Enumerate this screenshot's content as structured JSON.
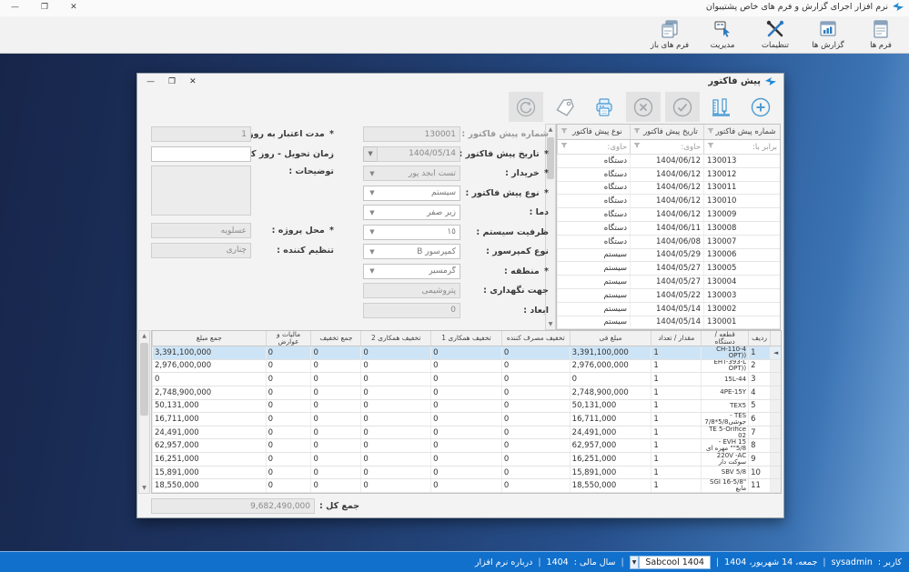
{
  "window": {
    "title": "نرم افزار اجرای گزارش و فرم های خاص پشتیبوان",
    "controls": {
      "close": "✕",
      "maximize": "❐",
      "minimize": "—"
    }
  },
  "ribbon": {
    "buttons": [
      {
        "id": "forms",
        "label": "فرم ها"
      },
      {
        "id": "reports",
        "label": "گزارش ها"
      },
      {
        "id": "settings",
        "label": "تنظیمات"
      },
      {
        "id": "management",
        "label": "مدیریت"
      },
      {
        "id": "open-forms",
        "label": "فرم های باز"
      }
    ]
  },
  "dialog": {
    "title": "پیش فاکتور",
    "controls": {
      "close": "✕",
      "maximize": "❐",
      "minimize": "—"
    },
    "toolbar": [
      {
        "name": "add",
        "enabled": true
      },
      {
        "name": "design",
        "enabled": true
      },
      {
        "name": "confirm",
        "enabled": false
      },
      {
        "name": "cancel",
        "enabled": false
      },
      {
        "name": "print",
        "enabled": true
      },
      {
        "name": "tag",
        "enabled": true
      },
      {
        "name": "refresh",
        "enabled": false
      }
    ],
    "list": {
      "columns": [
        "شماره پیش فاکتور",
        "تاریخ پیش فاکتور",
        "نوع پیش فاکتور"
      ],
      "filters": [
        "برابر با:",
        "حاوی:",
        "حاوی:"
      ],
      "rows": [
        [
          "130013",
          "1404/06/12",
          "دستگاه"
        ],
        [
          "130012",
          "1404/06/12",
          "دستگاه"
        ],
        [
          "130011",
          "1404/06/12",
          "دستگاه"
        ],
        [
          "130010",
          "1404/06/12",
          "دستگاه"
        ],
        [
          "130009",
          "1404/06/12",
          "دستگاه"
        ],
        [
          "130008",
          "1404/06/11",
          "دستگاه"
        ],
        [
          "130007",
          "1404/06/08",
          "دستگاه"
        ],
        [
          "130006",
          "1404/05/29",
          "سیستم"
        ],
        [
          "130005",
          "1404/05/27",
          "سیستم"
        ],
        [
          "130004",
          "1404/05/27",
          "سیستم"
        ],
        [
          "130003",
          "1404/05/22",
          "سیستم"
        ],
        [
          "130002",
          "1404/05/14",
          "سیستم"
        ],
        [
          "130001",
          "1404/05/14",
          "سیستم"
        ]
      ]
    },
    "form": {
      "center": [
        {
          "label": "شماره پیش فاکتور :",
          "value": "130001",
          "type": "readonly",
          "required": false,
          "dim": true
        },
        {
          "label": "تاریخ پیش فاکتور :",
          "value": "1404/05/14",
          "type": "datedrop",
          "required": true
        },
        {
          "label": "خریدار :",
          "value": "تست ابجد پور",
          "type": "dropdown-gray",
          "required": true
        },
        {
          "label": "نوع پیش فاکتور :",
          "value": "سیستم",
          "type": "dropdown",
          "required": true
        },
        {
          "label": "دما :",
          "value": "زیر صفر",
          "type": "dropdown",
          "required": false
        },
        {
          "label": "ظرفیت سیستم :",
          "value": "١٥",
          "type": "dropdown",
          "required": false
        },
        {
          "label": "نوع کمپرسور :",
          "value": "کمپرسور B",
          "type": "dropdown",
          "required": false
        },
        {
          "label": "منطقه :",
          "value": "گرمسیر",
          "type": "dropdown",
          "required": true
        },
        {
          "label": "جهت نگهداری :",
          "value": "پتروشیمی",
          "type": "readonly",
          "required": false
        },
        {
          "label": "ابعاد :",
          "value": "0",
          "type": "readonly",
          "required": false
        }
      ],
      "left": [
        {
          "label": "مدت اعتبار به روز :",
          "value": "1",
          "type": "readonly",
          "required": true
        },
        {
          "label": "زمان تحویل - روز کاری :",
          "value": "",
          "type": "text",
          "required": false
        },
        {
          "label": "توضیحات :",
          "value": "",
          "type": "textarea",
          "required": false
        },
        {
          "label": "محل پروژه :",
          "value": "عسلویه",
          "type": "readonly",
          "required": true
        },
        {
          "label": "تنظیم کننده :",
          "value": "چناری",
          "type": "readonly",
          "required": false
        }
      ]
    },
    "items": {
      "columns": [
        "ردیف",
        "قطعه / دستگاه",
        "مقدار / تعداد",
        "مبلغ فی",
        "تخفیف مصرف کننده",
        "تخفیف همکاری 1",
        "تخفیف همکاری 2",
        "جمع تخفیف",
        "مالیات و عوارض",
        "جمع مبلغ"
      ],
      "selected_row": 0,
      "rows": [
        [
          "1",
          "CH-110-4\n((OPT",
          "1",
          "3,391,100,000",
          "0",
          "0",
          "0",
          "0",
          "0",
          "3,391,100,000"
        ],
        [
          "2",
          "EHT-393-L\n((OPT",
          "1",
          "2,976,000,000",
          "0",
          "0",
          "0",
          "0",
          "0",
          "2,976,000,000"
        ],
        [
          "3",
          "15L-44",
          "1",
          "0",
          "0",
          "0",
          "0",
          "0",
          "0",
          "0"
        ],
        [
          "4",
          "4PE-15Y",
          "1",
          "2,748,900,000",
          "0",
          "0",
          "0",
          "0",
          "0",
          "2,748,900,000"
        ],
        [
          "5",
          "TEX5",
          "1",
          "50,131,000",
          "0",
          "0",
          "0",
          "0",
          "0",
          "50,131,000"
        ],
        [
          "6",
          "TES -\nجوشی5/8*7/8",
          "1",
          "16,711,000",
          "0",
          "0",
          "0",
          "0",
          "0",
          "16,711,000"
        ],
        [
          "7",
          "TE 5-Orifice\n02",
          "1",
          "24,491,000",
          "0",
          "0",
          "0",
          "0",
          "0",
          "24,491,000"
        ],
        [
          "8",
          "EVH 15 -\n5/8\"\" مهره ای",
          "1",
          "62,957,000",
          "0",
          "0",
          "0",
          "0",
          "0",
          "62,957,000"
        ],
        [
          "9",
          "220V -AC\nسوکت دار",
          "1",
          "16,251,000",
          "0",
          "0",
          "0",
          "0",
          "0",
          "16,251,000"
        ],
        [
          "10",
          "SBV 5/8",
          "1",
          "15,891,000",
          "0",
          "0",
          "0",
          "0",
          "0",
          "15,891,000"
        ],
        [
          "11",
          "\"SGI 16-5/8\nمایع",
          "1",
          "18,550,000",
          "0",
          "0",
          "0",
          "0",
          "0",
          "18,550,000"
        ]
      ]
    },
    "grand_total": {
      "label": "جمع کل :",
      "value": "9,682,490,000"
    }
  },
  "statusbar": {
    "user_label": "کاربر :",
    "user": "sysadmin",
    "date": "جمعه، 14 شهریور، 1404",
    "database": "Sabcool 1404",
    "fiscal_label": "سال مالی :",
    "fiscal_year": "1404",
    "about": "درباره نرم افزار",
    "separator": "|"
  }
}
